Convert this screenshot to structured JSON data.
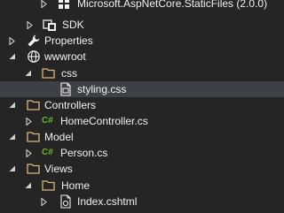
{
  "tree": {
    "items": [
      {
        "label": "Microsoft.AspNetCore.StaticFiles (2.0.0)",
        "icon": "package-icon",
        "expanded": false
      },
      {
        "label": "SDK",
        "icon": "sdk-icon",
        "expanded": false
      },
      {
        "label": "Properties",
        "icon": "wrench-icon",
        "expanded": false
      },
      {
        "label": "wwwroot",
        "icon": "globe-icon",
        "expanded": true
      },
      {
        "label": "css",
        "icon": "folder-icon",
        "expanded": true
      },
      {
        "label": "styling.css",
        "icon": "css-file-icon",
        "selected": true
      },
      {
        "label": "Controllers",
        "icon": "folder-icon",
        "expanded": true
      },
      {
        "label": "HomeController.cs",
        "icon": "csharp-file-icon",
        "icon_text": "C#",
        "expanded": false
      },
      {
        "label": "Model",
        "icon": "folder-icon",
        "expanded": true
      },
      {
        "label": "Person.cs",
        "icon": "csharp-file-icon",
        "icon_text": "C#",
        "expanded": false
      },
      {
        "label": "Views",
        "icon": "folder-icon",
        "expanded": true
      },
      {
        "label": "Home",
        "icon": "folder-icon",
        "expanded": true
      },
      {
        "label": "Index.cshtml",
        "icon": "cshtml-file-icon",
        "expanded": false
      }
    ]
  },
  "colors": {
    "background": "#252526",
    "selected_row": "#3f3f46",
    "text": "#f1f1f1",
    "folder": "#dcb67a",
    "csharp": "#68b723",
    "arrow": "#d0d0d0"
  }
}
